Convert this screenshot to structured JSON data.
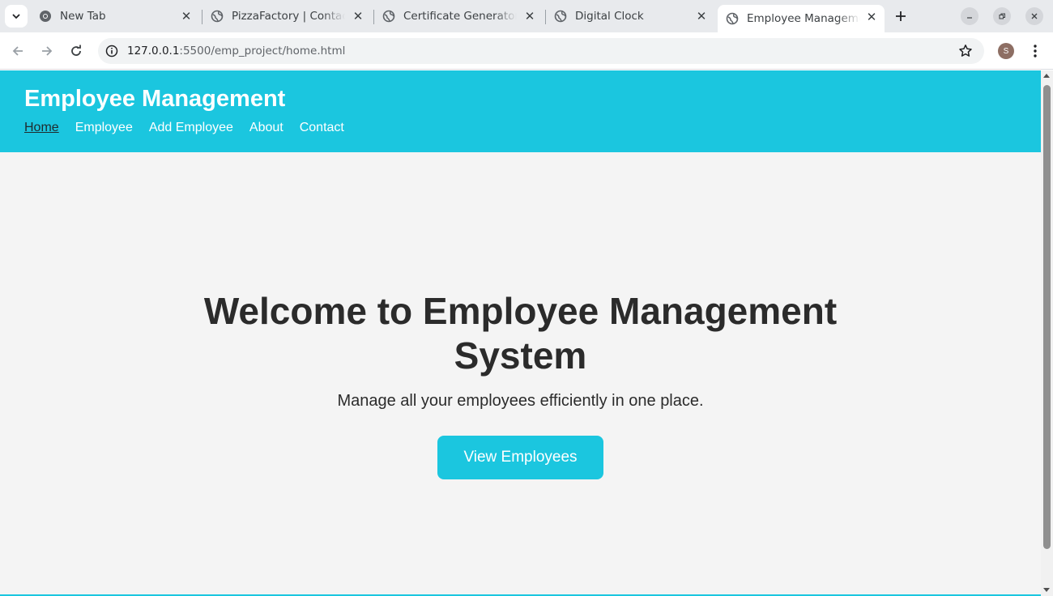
{
  "browser": {
    "tabs": [
      {
        "title": "New Tab",
        "icon": "chrome-icon",
        "active": false
      },
      {
        "title": "PizzaFactory | Contact",
        "icon": "globe-icon",
        "active": false
      },
      {
        "title": "Certificate Generator",
        "icon": "globe-icon",
        "active": false
      },
      {
        "title": "Digital Clock",
        "icon": "globe-icon",
        "active": false
      },
      {
        "title": "Employee Management",
        "icon": "globe-icon",
        "active": true
      }
    ],
    "url_host": "127.0.0.1",
    "url_rest": ":5500/emp_project/home.html",
    "profile_initial": "S"
  },
  "site": {
    "title": "Employee Management",
    "nav": [
      "Home",
      "Employee",
      "Add Employee",
      "About",
      "Contact"
    ],
    "current_nav": "Home",
    "accent_color": "#1bc6df"
  },
  "hero": {
    "heading": "Welcome to Employee Management System",
    "subtitle": "Manage all your employees efficiently in one place.",
    "button_label": "View Employees"
  }
}
